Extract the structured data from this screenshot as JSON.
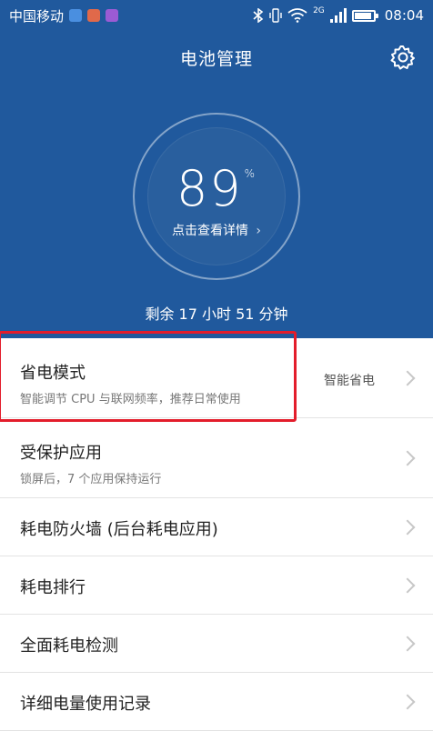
{
  "statusbar": {
    "carrier": "中国移动",
    "network": "2G",
    "time": "08:04",
    "battery_level_pct": 89,
    "icons": [
      "bluetooth-icon",
      "vibrate-icon",
      "wifi-icon",
      "signal-icon",
      "battery-icon"
    ]
  },
  "header": {
    "title": "电池管理",
    "settings_icon": "gear-icon",
    "battery_percent": "89",
    "percent_sign": "%",
    "details_link": "点击查看详情",
    "remaining": "剩余 17 小时 51 分钟"
  },
  "list": [
    {
      "title": "省电模式",
      "subtitle": "智能调节 CPU 与联网频率，推荐日常使用",
      "value": "智能省电"
    },
    {
      "title": "受保护应用",
      "subtitle": "锁屏后，7 个应用保持运行"
    },
    {
      "title": "耗电防火墙 (后台耗电应用)"
    },
    {
      "title": "耗电排行"
    },
    {
      "title": "全面耗电检测"
    },
    {
      "title": "详细电量使用记录"
    }
  ],
  "colors": {
    "header_bg": "#20599d",
    "highlight": "#e31d2b"
  }
}
